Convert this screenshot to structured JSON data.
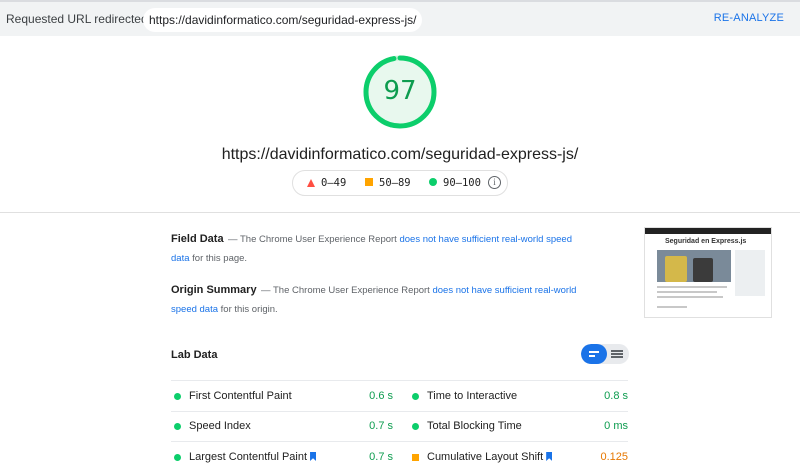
{
  "topbar": {
    "redirect_label": "Requested URL redirected to:",
    "redirect_url": "https://davidinformatico.com/seguridad-express-js/",
    "reanalyze": "RE-ANALYZE"
  },
  "score": {
    "value": "97",
    "fraction": 0.97,
    "color": "#0cce6b"
  },
  "page_url": "https://davidinformatico.com/seguridad-express-js/",
  "legend": {
    "fail": "0–49",
    "average": "50–89",
    "pass": "90–100",
    "info_icon": "i"
  },
  "field_data": {
    "title": "Field Data",
    "text_before": "— The Chrome User Experience Report",
    "link": "does not have sufficient real-world speed data",
    "text_after": "for this page."
  },
  "origin_summary": {
    "title": "Origin Summary",
    "text_before": "— The Chrome User Experience Report",
    "link": "does not have sufficient real-world speed data",
    "text_after": "for this origin."
  },
  "thumbnail": {
    "title": "Seguridad en Express.js"
  },
  "lab_data": {
    "title": "Lab Data",
    "metrics": [
      {
        "name": "First Contentful Paint",
        "value": "0.6 s",
        "status": "pass"
      },
      {
        "name": "Time to Interactive",
        "value": "0.8 s",
        "status": "pass"
      },
      {
        "name": "Speed Index",
        "value": "0.7 s",
        "status": "pass"
      },
      {
        "name": "Total Blocking Time",
        "value": "0 ms",
        "status": "pass"
      },
      {
        "name": "Largest Contentful Paint",
        "value": "0.7 s",
        "status": "pass",
        "flag": true
      },
      {
        "name": "Cumulative Layout Shift",
        "value": "0.125",
        "status": "average",
        "flag": true
      }
    ]
  },
  "colors": {
    "pass": "#0cce6b",
    "average": "#ffa400",
    "fail": "#ff4e42",
    "link": "#1a73e8"
  }
}
